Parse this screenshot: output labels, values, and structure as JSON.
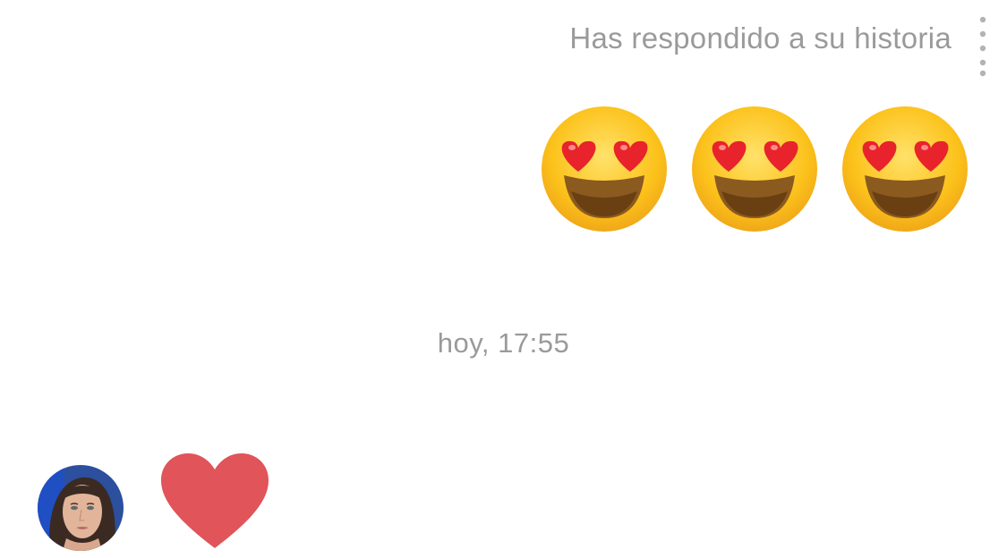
{
  "conversation": {
    "reply_note": "Has respondido a su historia",
    "sent_emojis": [
      "smiling-face-with-heart-eyes-icon",
      "smiling-face-with-heart-eyes-icon",
      "smiling-face-with-heart-eyes-icon"
    ],
    "timestamp": "hoy, 17:55",
    "received_reaction": "heart-icon"
  },
  "colors": {
    "secondary_text": "#9a9a9a",
    "heart": "#e0545a",
    "emoji_face": "#fcc21b",
    "emoji_heart": "#e8232b"
  }
}
